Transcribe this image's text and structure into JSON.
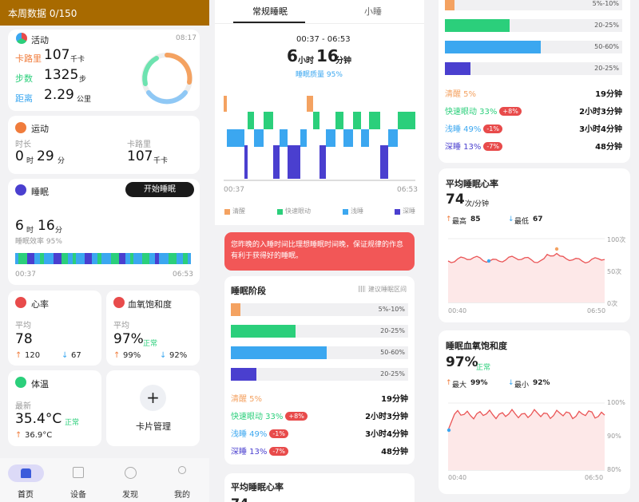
{
  "status_bar": {
    "title": "本周数据 0/150"
  },
  "colors": {
    "awake": "#f4a261",
    "rem": "#2bcf7b",
    "light": "#3ba7f0",
    "deep": "#4a3fcf",
    "heart": "#e84b4b",
    "accent_brown": "#a86a00"
  },
  "activity": {
    "title": "活动",
    "time": "08:17",
    "cal_label": "卡路里",
    "cal_value": "107",
    "cal_unit": "千卡",
    "steps_label": "步数",
    "steps_value": "1325",
    "steps_unit": "步",
    "dist_label": "距离",
    "dist_value": "2.29",
    "dist_unit": "公里"
  },
  "exercise": {
    "title": "运动",
    "dur_label": "时长",
    "dur_h": "0",
    "dur_h_unit": "时",
    "dur_m": "29",
    "dur_m_unit": "分",
    "cal_label": "卡路里",
    "cal_value": "107",
    "cal_unit": "千卡"
  },
  "sleep_card": {
    "title": "睡眠",
    "button": "开始睡眠",
    "hours": "6",
    "hours_unit": "时",
    "mins": "16",
    "mins_unit": "分",
    "efficiency": "睡眠效率 95%",
    "start": "00:37",
    "end": "06:53"
  },
  "heart_card": {
    "title": "心率",
    "avg_label": "平均",
    "avg": "78",
    "max": "120",
    "min": "67"
  },
  "spo2_card": {
    "title": "血氧饱和度",
    "avg_label": "平均",
    "avg": "97%",
    "status": "正常",
    "max": "99%",
    "min": "92%"
  },
  "temp_card": {
    "title": "体温",
    "latest_label": "最新",
    "value": "35.4°C",
    "status": "正常",
    "max": "36.9°C"
  },
  "card_manage": {
    "label": "卡片管理",
    "plus": "+"
  },
  "nav": {
    "items": [
      {
        "label": "首页",
        "icon": "home-icon"
      },
      {
        "label": "设备",
        "icon": "grid-icon"
      },
      {
        "label": "发现",
        "icon": "compass-icon"
      },
      {
        "label": "我的",
        "icon": "person-icon"
      }
    ]
  },
  "sleep_detail": {
    "tabs": [
      "常规睡眠",
      "小睡"
    ],
    "range": "00:37 - 06:53",
    "hours": "6",
    "hours_unit": "小时",
    "mins": "16",
    "mins_unit": "分钟",
    "quality": "睡眠质量 95%",
    "start": "00:37",
    "end": "06:53",
    "legend": [
      "清醒",
      "快速眼动",
      "浅睡",
      "深睡"
    ],
    "alert": "您昨晚的入睡时间比理想睡眠时间晚，保证规律的作息有利于获得好的睡眠。",
    "stages_title": "睡眠阶段",
    "suggest": "建议睡眠区间",
    "stages": [
      {
        "name": "清醒",
        "pct": "5%",
        "pill": "",
        "duration": "19分钟",
        "range": "5%-10%",
        "value": 5
      },
      {
        "name": "快速眼动",
        "pct": "33%",
        "pill": "+8%",
        "duration": "2小时3分钟",
        "range": "20-25%",
        "value": 33
      },
      {
        "name": "浅睡",
        "pct": "49%",
        "pill": "-1%",
        "duration": "3小时4分钟",
        "range": "50-60%",
        "value": 49
      },
      {
        "name": "深睡",
        "pct": "13%",
        "pill": "-7%",
        "duration": "48分钟",
        "range": "20-25%",
        "value": 13
      }
    ],
    "avg_hr_title": "平均睡眠心率",
    "avg_hr_value": "74"
  },
  "hr_detail": {
    "title": "平均睡眠心率",
    "value": "74",
    "unit": "次/分钟",
    "max_label": "最高",
    "max": "85",
    "min_label": "最低",
    "min": "67",
    "y_ticks": [
      "100次",
      "50次",
      "0次"
    ],
    "start": "00:40",
    "end": "06:50"
  },
  "spo2_detail": {
    "title": "睡眠血氧饱和度",
    "value": "97%",
    "status": "正常",
    "max_label": "最大",
    "max": "99%",
    "min_label": "最小",
    "min": "92%",
    "y_ticks": [
      "100%",
      "90%",
      "80%"
    ],
    "start": "00:40",
    "end": "06:50"
  }
}
